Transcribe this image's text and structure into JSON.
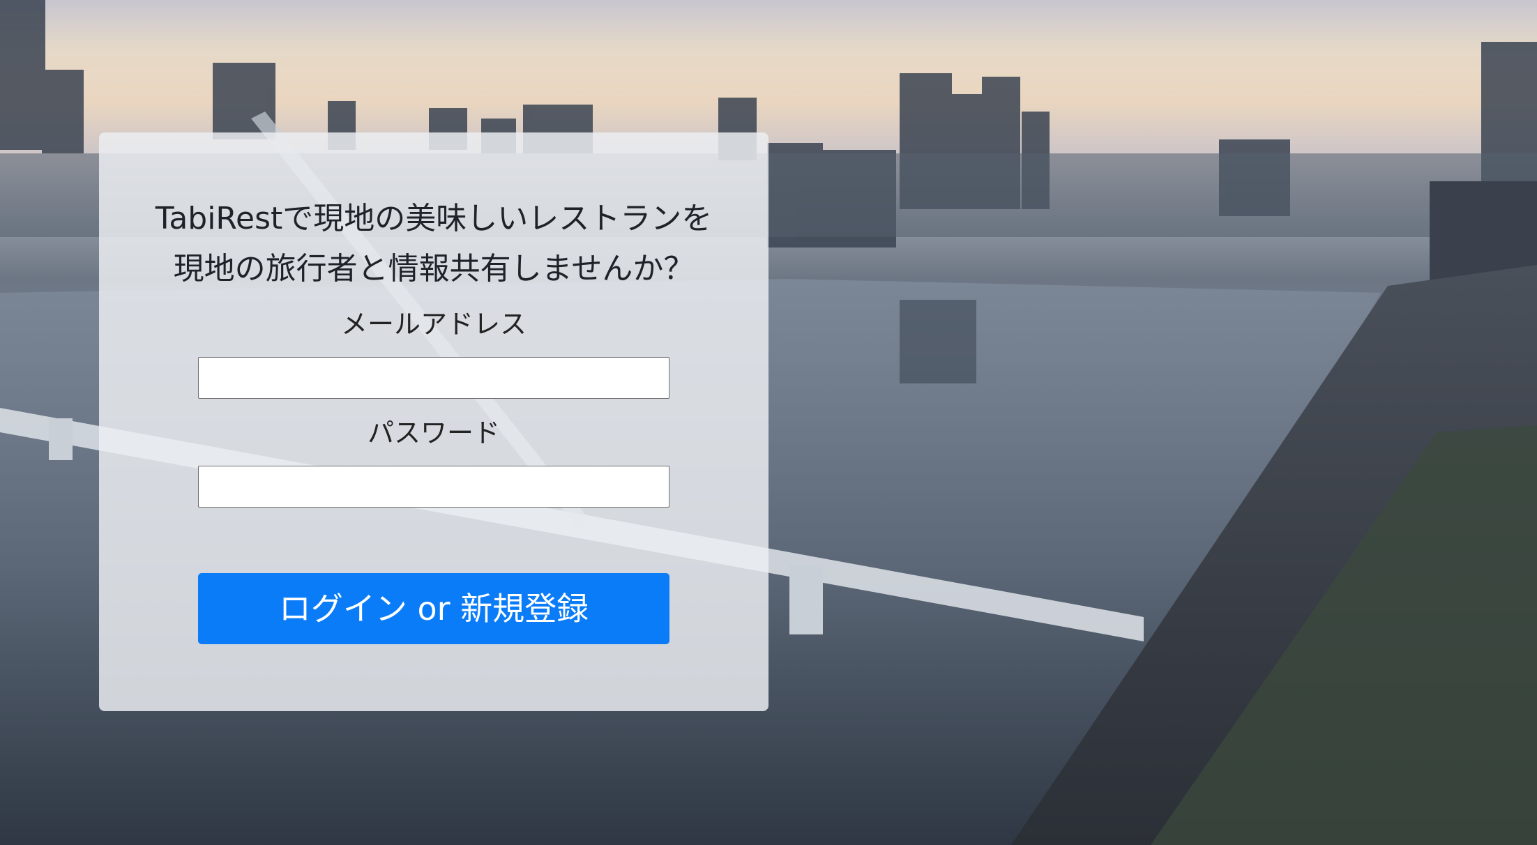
{
  "login_card": {
    "headline_line1": "TabiRestで現地の美味しいレストランを",
    "headline_line2": "現地の旅行者と情報共有しませんか？",
    "email_label": "メールアドレス",
    "email_value": "",
    "password_label": "パスワード",
    "password_value": "",
    "submit_label": "ログイン or 新規登録"
  },
  "colors": {
    "button": "#0a7cf8",
    "card_background": "rgba(236,238,242,0.84)"
  }
}
